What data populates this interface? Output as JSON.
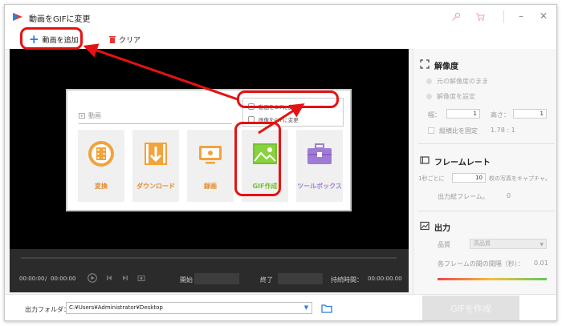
{
  "window": {
    "title": "動画をGIFに変更"
  },
  "toolbar": {
    "add_label": "動画を追加",
    "clear_label": "クリア"
  },
  "inset": {
    "section_label": "動画",
    "tiles": [
      {
        "label": "変換",
        "icon": "film-reel-icon"
      },
      {
        "label": "ダウンロード",
        "icon": "download-icon"
      },
      {
        "label": "録画",
        "icon": "screen-record-icon"
      },
      {
        "label": "GIF作成",
        "icon": "image-icon"
      },
      {
        "label": "ツールボックス",
        "icon": "toolbox-icon"
      }
    ],
    "menu": [
      {
        "label": "動画をGIFに変更"
      },
      {
        "label": "画像をGIFに変更"
      }
    ]
  },
  "playback": {
    "current_time": "00:00:00",
    "separator": "/",
    "total_time": "00:00:00",
    "start_label": "開始",
    "end_label": "終了",
    "duration_label": "持続時間：",
    "duration_value": "00:00:00.00"
  },
  "panel": {
    "resolution": {
      "title": "解像度",
      "option_original": "元の解像度のまま",
      "option_custom": "解像度を設定",
      "width_label": "幅：",
      "width_value": "1",
      "height_label": "高さ：",
      "height_value": "1",
      "keep_ratio_label": "縦横比を固定",
      "ratio_value": "1.78 : 1"
    },
    "framerate": {
      "title": "フレームレート",
      "per_second_prefix": "1秒ごとに",
      "per_second_value": "10",
      "per_second_suffix": "枚の写真をキャプチャ。",
      "output_frames_label": "出力総フレーム。",
      "output_frames_value": "0"
    },
    "output": {
      "title": "出力",
      "quality_label": "品質",
      "quality_value": "高品質",
      "interval_label": "各フレームの間の間隔（秒）：",
      "interval_value": "0.01"
    }
  },
  "bottom": {
    "folder_label": "出力フォルダ：",
    "folder_path": "C:¥Users¥Administrator¥Desktop",
    "create_label": "GIFを作成"
  },
  "colors": {
    "accent": "#2a7ce0",
    "annotation": "#e51212",
    "tile_text": "#e48a2e",
    "gif_tile": "#74c12f"
  }
}
